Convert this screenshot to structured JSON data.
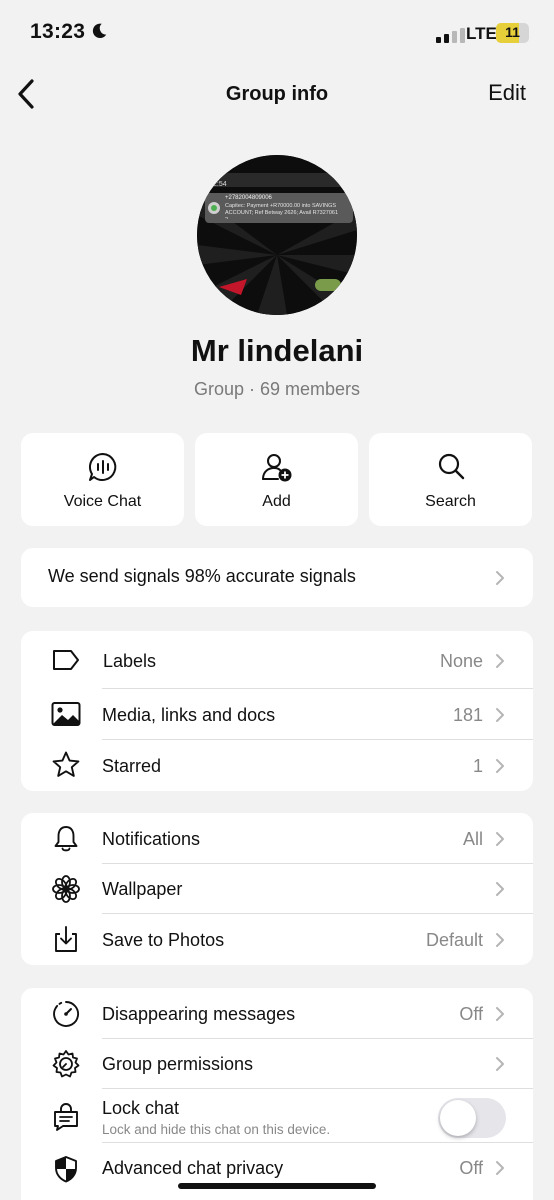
{
  "status": {
    "time": "13:23",
    "network": "LTE",
    "battery": "11",
    "moon_icon": "moon-icon"
  },
  "nav": {
    "title": "Group info",
    "edit": "Edit",
    "back_icon": "chevron-left-icon"
  },
  "group": {
    "name": "Mr lindelani",
    "subtitle": "Group · 69 members",
    "avatar_notification_number": "+27820048090​06",
    "avatar_notification_text": "Capitec: Payment +R70000.00 into SAVINGS ACCOUNT; Ref Betway 2626; Avail R7327061 2...",
    "avatar_time": "2:54"
  },
  "actions": [
    {
      "label": "Voice Chat",
      "icon": "voice-chat-icon"
    },
    {
      "label": "Add",
      "icon": "add-person-icon"
    },
    {
      "label": "Search",
      "icon": "search-icon"
    }
  ],
  "description": "We send signals 98% accurate signals",
  "section1": [
    {
      "title": "Labels",
      "value": "None",
      "icon": "label-icon"
    },
    {
      "title": "Media, links and docs",
      "value": "181",
      "icon": "photo-icon"
    },
    {
      "title": "Starred",
      "value": "1",
      "icon": "star-icon"
    }
  ],
  "section2": [
    {
      "title": "Notifications",
      "value": "All",
      "icon": "bell-icon"
    },
    {
      "title": "Wallpaper",
      "value": "",
      "icon": "flower-icon"
    },
    {
      "title": "Save to Photos",
      "value": "Default",
      "icon": "download-icon"
    }
  ],
  "section3": [
    {
      "title": "Disappearing messages",
      "value": "Off",
      "icon": "timer-icon"
    },
    {
      "title": "Group permissions",
      "value": "",
      "icon": "settings-gear-icon"
    },
    {
      "title": "Lock chat",
      "subtitle": "Lock and hide this chat on this device.",
      "toggle_on": false,
      "icon": "lock-chat-icon"
    },
    {
      "title": "Advanced chat privacy",
      "value": "Off",
      "icon": "shield-icon"
    }
  ]
}
